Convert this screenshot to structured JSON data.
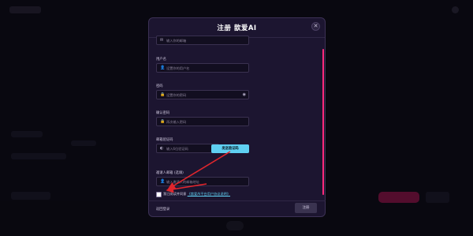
{
  "modal": {
    "title": "注册 歆爱AI",
    "close_icon": "close-icon"
  },
  "form": {
    "email_placeholder": "输入你的邮箱",
    "username_label": "用户名",
    "username_placeholder": "设置你的用户名",
    "password_label": "密码",
    "password_placeholder": "设置你的密码",
    "confirm_label": "确认密码",
    "confirm_placeholder": "再次输入密码",
    "code_label": "邮箱验证码",
    "code_placeholder": "输入6位验证码",
    "send_code": "发送验证码",
    "inviter_label": "邀请人邮箱 (选填)",
    "inviter_placeholder": "输入邀请人的邮箱地址",
    "agree_prefix": "我已阅读并同意",
    "agree_link": "《歆爱AI平台用户协议说明》",
    "agree_checked": false
  },
  "footer": {
    "back": "返回登录",
    "register": "注册"
  },
  "colors": {
    "accent_cyan": "#5fd0f2",
    "scrollbar_pink": "#ff2a7a",
    "annotation_red": "#e0262d"
  }
}
